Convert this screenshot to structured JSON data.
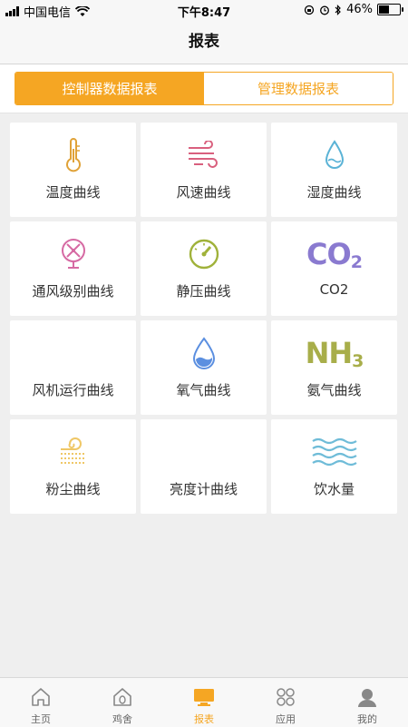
{
  "status_bar": {
    "carrier": "中国电信",
    "time": "下午8:47",
    "battery": "46%",
    "battery_level": 0.46
  },
  "header": {
    "title": "报表"
  },
  "segment": {
    "tabs": [
      {
        "label": "控制器数据报表",
        "active": true
      },
      {
        "label": "管理数据报表",
        "active": false
      }
    ]
  },
  "tiles": [
    {
      "label": "温度曲线",
      "icon": "thermometer-icon",
      "color": "#e0a238"
    },
    {
      "label": "风速曲线",
      "icon": "wind-icon",
      "color": "#d9607e"
    },
    {
      "label": "湿度曲线",
      "icon": "water-drop-icon",
      "color": "#5bb3d6"
    },
    {
      "label": "通风级别曲线",
      "icon": "fan-icon",
      "color": "#d66aa3"
    },
    {
      "label": "静压曲线",
      "icon": "gauge-icon",
      "color": "#a0b23a"
    },
    {
      "label": "CO2",
      "icon": "co2-icon",
      "icon_text": "CO",
      "icon_sub": "2",
      "color": "#8a7ad0"
    },
    {
      "label": "风机运行曲线",
      "icon": "none"
    },
    {
      "label": "氧气曲线",
      "icon": "oxygen-drop-icon",
      "color": "#5b8fe0"
    },
    {
      "label": "氨气曲线",
      "icon": "nh3-icon",
      "icon_text": "NH",
      "icon_sub": "3",
      "color": "#a8ae4a"
    },
    {
      "label": "粉尘曲线",
      "icon": "dust-icon",
      "color": "#efc766"
    },
    {
      "label": "亮度计曲线",
      "icon": "none"
    },
    {
      "label": "饮水量",
      "icon": "water-waves-icon",
      "color": "#6fbcd8"
    }
  ],
  "tabbar": {
    "items": [
      {
        "label": "主页",
        "icon": "home-icon",
        "active": false
      },
      {
        "label": "鸡舍",
        "icon": "henhouse-icon",
        "active": false
      },
      {
        "label": "报表",
        "icon": "report-monitor-icon",
        "active": true
      },
      {
        "label": "应用",
        "icon": "apps-icon",
        "active": false
      },
      {
        "label": "我的",
        "icon": "profile-icon",
        "active": false
      }
    ]
  },
  "colors": {
    "accent": "#f5a623",
    "background": "#efefef",
    "tile": "#ffffff"
  }
}
